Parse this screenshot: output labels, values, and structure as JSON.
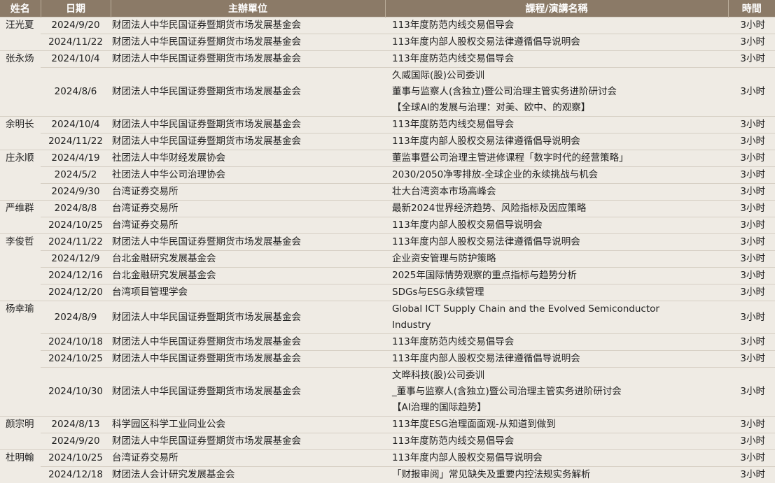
{
  "headers": {
    "name": "姓名",
    "date": "日期",
    "org": "主辦單位",
    "course": "課程/演講名稱",
    "hours": "時間"
  },
  "rows": [
    {
      "name": "汪光夏",
      "date": "2024/9/20",
      "org": "财团法人中华民国证券暨期货市场发展基金会",
      "course": [
        "113年度防范内线交易倡导会"
      ],
      "hours": "3小时"
    },
    {
      "name": "",
      "date": "2024/11/22",
      "org": "财团法人中华民国证券暨期货市场发展基金会",
      "course": [
        "113年度内部人股权交易法律遵循倡导说明会"
      ],
      "hours": "3小时"
    },
    {
      "name": "张永炀",
      "date": "2024/10/4",
      "org": "财团法人中华民国证券暨期货市场发展基金会",
      "course": [
        "113年度防范内线交易倡导会"
      ],
      "hours": "3小时"
    },
    {
      "name": "",
      "date": "2024/8/6",
      "org": "财团法人中华民国证券暨期货市场发展基金会",
      "course": [
        "久威国际(股)公司委训",
        "董事与监察人(含独立)暨公司治理主管实务进阶研讨会",
        "【全球AI的发展与治理：对美、欧中、的观察】"
      ],
      "hours": "3小时"
    },
    {
      "name": "余明长",
      "date": "2024/10/4",
      "org": "财团法人中华民国证券暨期货市场发展基金会",
      "course": [
        "113年度防范内线交易倡导会"
      ],
      "hours": "3小时"
    },
    {
      "name": "",
      "date": "2024/11/22",
      "org": "财团法人中华民国证券暨期货市场发展基金会",
      "course": [
        "113年度内部人股权交易法律遵循倡导说明会"
      ],
      "hours": "3小时"
    },
    {
      "name": "庄永顺",
      "date": "2024/4/19",
      "org": "社团法人中华财经发展协会",
      "course": [
        "董监事暨公司治理主管进修课程「数字时代的经营策略」"
      ],
      "hours": "3小时"
    },
    {
      "name": "",
      "date": "2024/5/2",
      "org": "社团法人中华公司治理协会",
      "course": [
        "2030/2050净零排放-全球企业的永续挑战与机会"
      ],
      "hours": "3小时"
    },
    {
      "name": "",
      "date": "2024/9/30",
      "org": "台湾证券交易所",
      "course": [
        "壮大台湾资本市场高峰会"
      ],
      "hours": "3小时"
    },
    {
      "name": "严维群",
      "date": "2024/8/8",
      "org": "台湾证券交易所",
      "course": [
        "最新2024世界经济趋势、风险指标及因应策略"
      ],
      "hours": "3小时"
    },
    {
      "name": "",
      "date": "2024/10/25",
      "org": "台湾证券交易所",
      "course": [
        "113年度内部人股权交易倡导说明会"
      ],
      "hours": "3小时"
    },
    {
      "name": "李俊哲",
      "date": "2024/11/22",
      "org": "财团法人中华民国证券暨期货市场发展基金会",
      "course": [
        "113年度内部人股权交易法律遵循倡导说明会"
      ],
      "hours": "3小时"
    },
    {
      "name": "",
      "date": "2024/12/9",
      "org": "台北金融研究发展基金会",
      "course": [
        "企业资安管理与防护策略"
      ],
      "hours": "3小时"
    },
    {
      "name": "",
      "date": "2024/12/16",
      "org": "台北金融研究发展基金会",
      "course": [
        "2025年国际情势观察的重点指标与趋势分析"
      ],
      "hours": "3小时"
    },
    {
      "name": "",
      "date": "2024/12/20",
      "org": "台湾项目管理学会",
      "course": [
        "SDGs与ESG永续管理"
      ],
      "hours": "3小时"
    },
    {
      "name": "杨幸瑜",
      "date": "2024/8/9",
      "org": "财团法人中华民国证券暨期货市场发展基金会",
      "course": [
        "Global ICT Supply Chain and the Evolved Semiconductor",
        "Industry"
      ],
      "hours": "3小时"
    },
    {
      "name": "",
      "date": "2024/10/18",
      "org": "财团法人中华民国证券暨期货市场发展基金会",
      "course": [
        "113年度防范内线交易倡导会"
      ],
      "hours": "3小时"
    },
    {
      "name": "",
      "date": "2024/10/25",
      "org": "财团法人中华民国证券暨期货市场发展基金会",
      "course": [
        "113年度内部人股权交易法律遵循倡导说明会"
      ],
      "hours": "3小时"
    },
    {
      "name": "",
      "date": "2024/10/30",
      "org": "财团法人中华民国证券暨期货市场发展基金会",
      "course": [
        "文晔科技(股)公司委训",
        "_董事与监察人(含独立)暨公司治理主管实务进阶研讨会",
        "【AI治理的国际趋势】"
      ],
      "hours": "3小时"
    },
    {
      "name": "颜宗明",
      "date": "2024/8/13",
      "org": "科学园区科学工业同业公会",
      "course": [
        "113年度ESG治理面面观-从知道到做到"
      ],
      "hours": "3小时"
    },
    {
      "name": "",
      "date": "2024/9/20",
      "org": "财团法人中华民国证券暨期货市场发展基金会",
      "course": [
        "113年度防范内线交易倡导会"
      ],
      "hours": "3小时"
    },
    {
      "name": "杜明翰",
      "date": "2024/10/25",
      "org": "台湾证券交易所",
      "course": [
        "113年度内部人股权交易倡导说明会"
      ],
      "hours": "3小时"
    },
    {
      "name": "",
      "date": "2024/12/18",
      "org": "财团法人会计研究发展基金会",
      "course": [
        "「财报审阅」常见缺失及重要内控法规实务解析"
      ],
      "hours": "3小时"
    }
  ]
}
